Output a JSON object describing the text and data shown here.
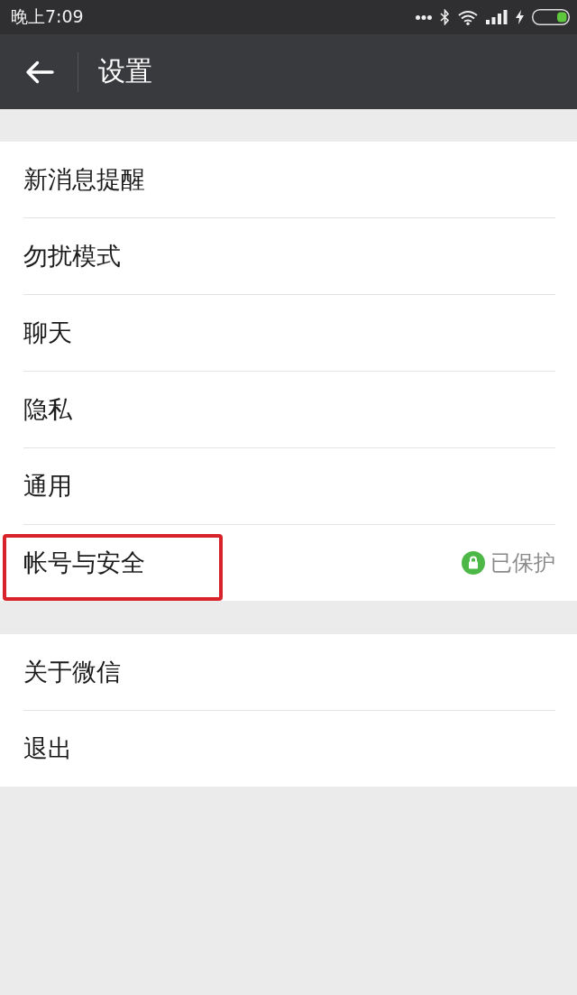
{
  "status_bar": {
    "time": "晚上7:09"
  },
  "header": {
    "title": "设置"
  },
  "groups": [
    {
      "items": [
        {
          "label": "新消息提醒",
          "highlighted": false
        },
        {
          "label": "勿扰模式",
          "highlighted": false
        },
        {
          "label": "聊天",
          "highlighted": false
        },
        {
          "label": "隐私",
          "highlighted": false
        },
        {
          "label": "通用",
          "highlighted": false
        },
        {
          "label": "帐号与安全",
          "highlighted": true,
          "status": "已保护"
        }
      ]
    },
    {
      "items": [
        {
          "label": "关于微信",
          "highlighted": false
        },
        {
          "label": "退出",
          "highlighted": false
        }
      ]
    }
  ]
}
